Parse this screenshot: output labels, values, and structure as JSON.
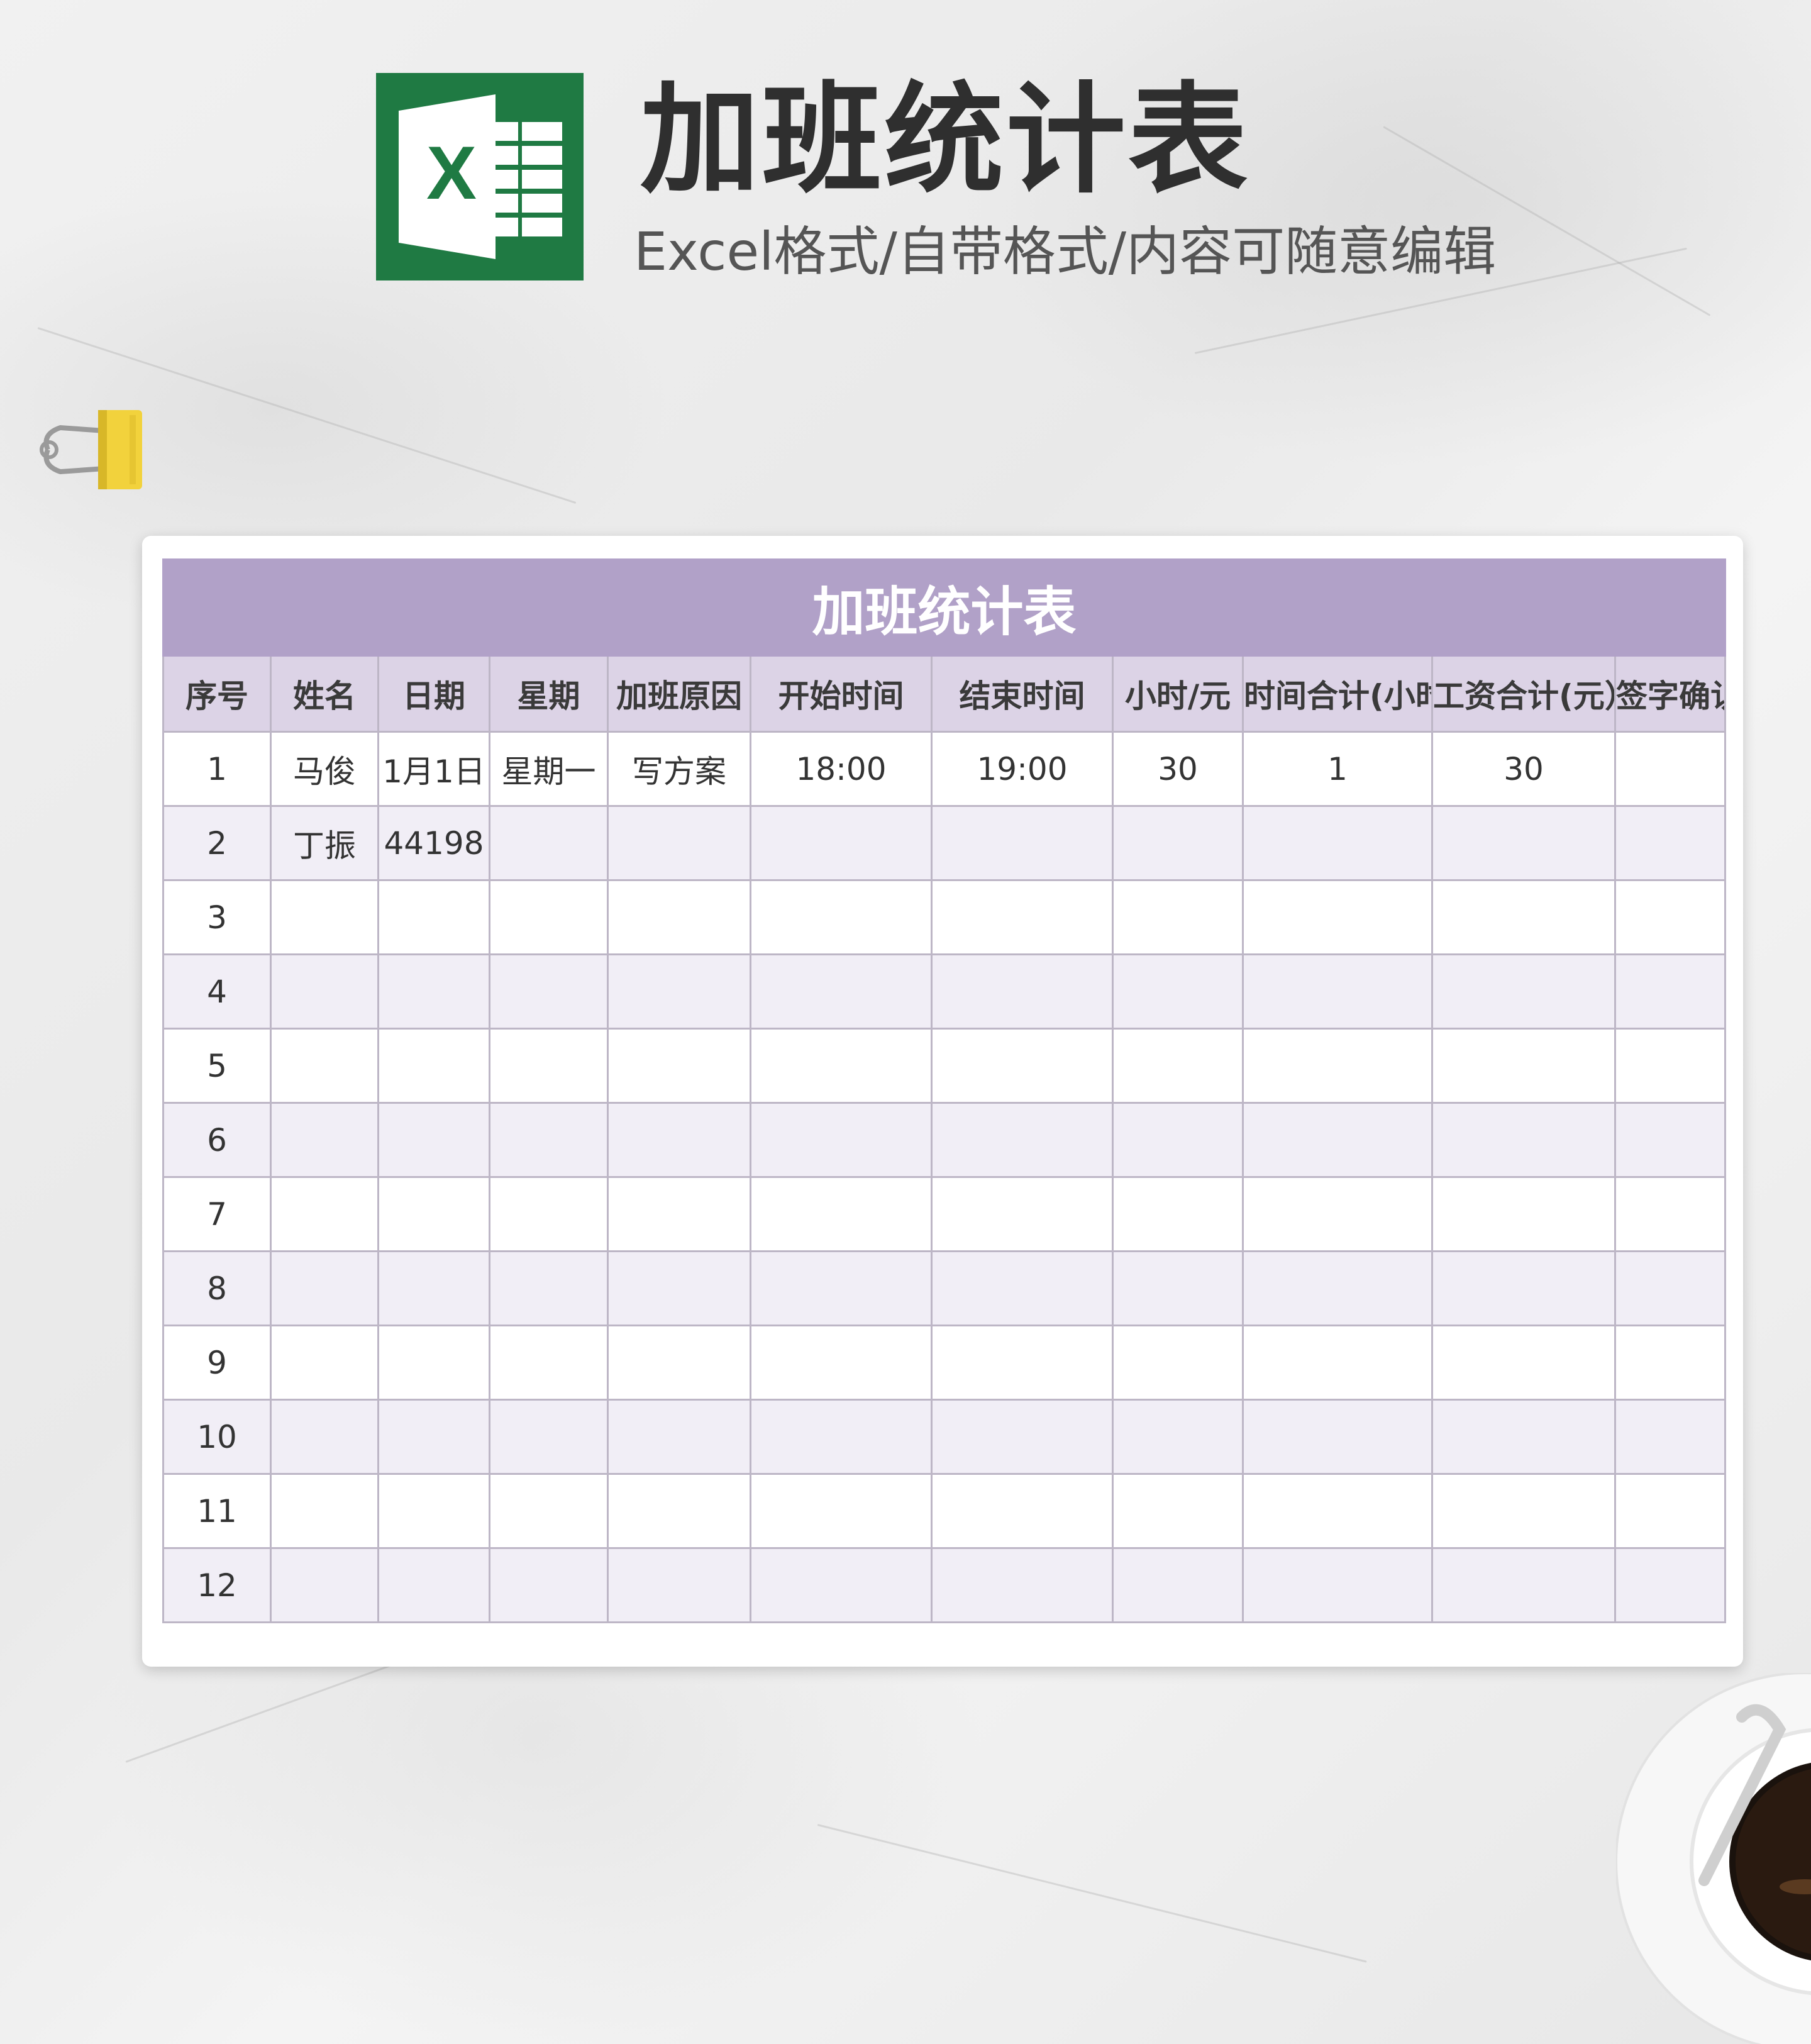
{
  "header": {
    "title": "加班统计表",
    "subtitle": "Excel格式/自带格式/内容可随意编辑",
    "logo_letter": "X",
    "logo_color": "#1f7a43"
  },
  "sheet": {
    "title": "加班统计表",
    "accent_color": "#b1a1c8",
    "columns": [
      "序号",
      "姓名",
      "日期",
      "星期",
      "加班原因",
      "开始时间",
      "结束时间",
      "小时/元",
      "时间合计(小时）",
      "工资合计(元）",
      "签字确认"
    ],
    "rows": [
      [
        "1",
        "马俊",
        "1月1日",
        "星期一",
        "写方案",
        "18:00",
        "19:00",
        "30",
        "1",
        "30",
        ""
      ],
      [
        "2",
        "丁振",
        "44198",
        "",
        "",
        "",
        "",
        "",
        "",
        "",
        ""
      ],
      [
        "3",
        "",
        "",
        "",
        "",
        "",
        "",
        "",
        "",
        "",
        ""
      ],
      [
        "4",
        "",
        "",
        "",
        "",
        "",
        "",
        "",
        "",
        "",
        ""
      ],
      [
        "5",
        "",
        "",
        "",
        "",
        "",
        "",
        "",
        "",
        "",
        ""
      ],
      [
        "6",
        "",
        "",
        "",
        "",
        "",
        "",
        "",
        "",
        "",
        ""
      ],
      [
        "7",
        "",
        "",
        "",
        "",
        "",
        "",
        "",
        "",
        "",
        ""
      ],
      [
        "8",
        "",
        "",
        "",
        "",
        "",
        "",
        "",
        "",
        "",
        ""
      ],
      [
        "9",
        "",
        "",
        "",
        "",
        "",
        "",
        "",
        "",
        "",
        ""
      ],
      [
        "10",
        "",
        "",
        "",
        "",
        "",
        "",
        "",
        "",
        "",
        ""
      ],
      [
        "11",
        "",
        "",
        "",
        "",
        "",
        "",
        "",
        "",
        "",
        ""
      ],
      [
        "12",
        "",
        "",
        "",
        "",
        "",
        "",
        "",
        "",
        "",
        ""
      ]
    ]
  },
  "decor": {
    "clip_icon": "binder-clip-icon",
    "coffee_icon": "coffee-cup-icon"
  }
}
